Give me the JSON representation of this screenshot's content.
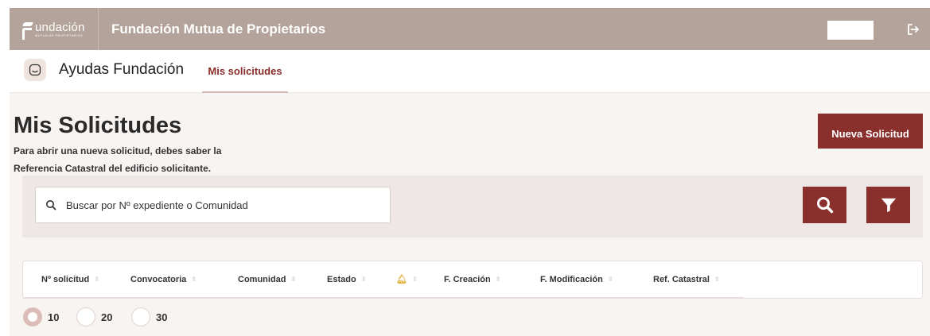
{
  "header": {
    "logo_word": "undación",
    "logo_sub": "MUTUA DE PROPIETARIOS",
    "title": "Fundación Mutua de Propietarios",
    "logout_icon": "logout-icon"
  },
  "subnav": {
    "app_title": "Ayudas Fundación",
    "tab_label": "Mis solicitudes"
  },
  "main": {
    "title": "Mis Solicitudes",
    "description": "Para abrir una nueva solicitud, debes saber la Referencia Catastral del edificio solicitante.",
    "new_button": "Nueva Solicitud"
  },
  "search": {
    "placeholder": "Buscar por Nº expediente o Comunidad"
  },
  "table": {
    "columns": [
      "Nº solicitud",
      "Convocatoria",
      "Comunidad",
      "Estado",
      "",
      "F. Creación",
      "F. Modificación",
      "Ref. Catastral"
    ]
  },
  "pagination": {
    "options": [
      "10",
      "20",
      "30"
    ],
    "selected": "10"
  },
  "colors": {
    "header_bg": "#b3a39b",
    "accent": "#8a302c",
    "page_bg": "#f8f4f2"
  }
}
